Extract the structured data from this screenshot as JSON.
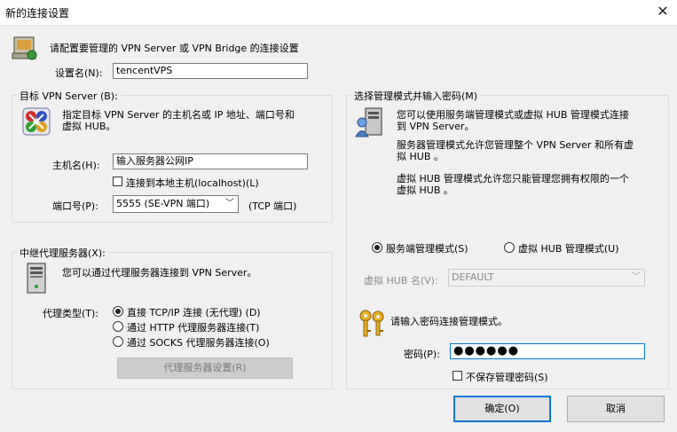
{
  "window": {
    "title": "新的连接设置"
  },
  "header": {
    "instruction": "请配置要管理的 VPN Server 或 VPN Bridge 的连接设置"
  },
  "setting_name": {
    "label": "设置名(N):",
    "value": "tencentVPS"
  },
  "target": {
    "legend": "目标 VPN Server (B):",
    "description_line1": "指定目标 VPN Server 的主机名或 IP 地址、端口号和",
    "description_line2": "虚拟 HUB。",
    "host_label": "主机名(H):",
    "host_value": "输入服务器公网IP",
    "localhost_checkbox": "连接到本地主机(localhost)(L)",
    "port_label": "端口号(P):",
    "port_value": "5555 (SE-VPN 端口)",
    "port_unit": "(TCP 端口)"
  },
  "proxy": {
    "legend": "中继代理服务器(X):",
    "description": "您可以通过代理服务器连接到 VPN Server。",
    "type_label": "代理类型(T):",
    "options": [
      "直接 TCP/IP 连接 (无代理) (D)",
      "通过 HTTP 代理服务器连接(T)",
      "通过 SOCKS 代理服务器连接(O)"
    ],
    "settings_button": "代理服务器设置(R)"
  },
  "admin_mode": {
    "legend": "选择管理模式并输入密码(M)",
    "para1_line1": "您可以使用服务端管理模式或虚拟 HUB 管理模式连接",
    "para1_line2": "到 VPN Server。",
    "para2_line1": "服务器管理模式允许您管理整个 VPN Server 和所有虚",
    "para2_line2": "拟 HUB 。",
    "para3_line1": "虚拟 HUB 管理模式允许您只能管理您拥有权限的一个",
    "para3_line2": "虚拟 HUB 。",
    "server_mode": "服务端管理模式(S)",
    "hub_mode": "虚拟 HUB 管理模式(U)",
    "hub_name_label": "虚拟 HUB 名(V):",
    "hub_name_value": "DEFAULT",
    "password_prompt": "请输入密码连接管理模式。",
    "password_label": "密码(P):",
    "password_value": "●●●●●●",
    "no_save_checkbox": "不保存管理密码(S)"
  },
  "buttons": {
    "ok": "确定(O)",
    "cancel": "取消"
  }
}
